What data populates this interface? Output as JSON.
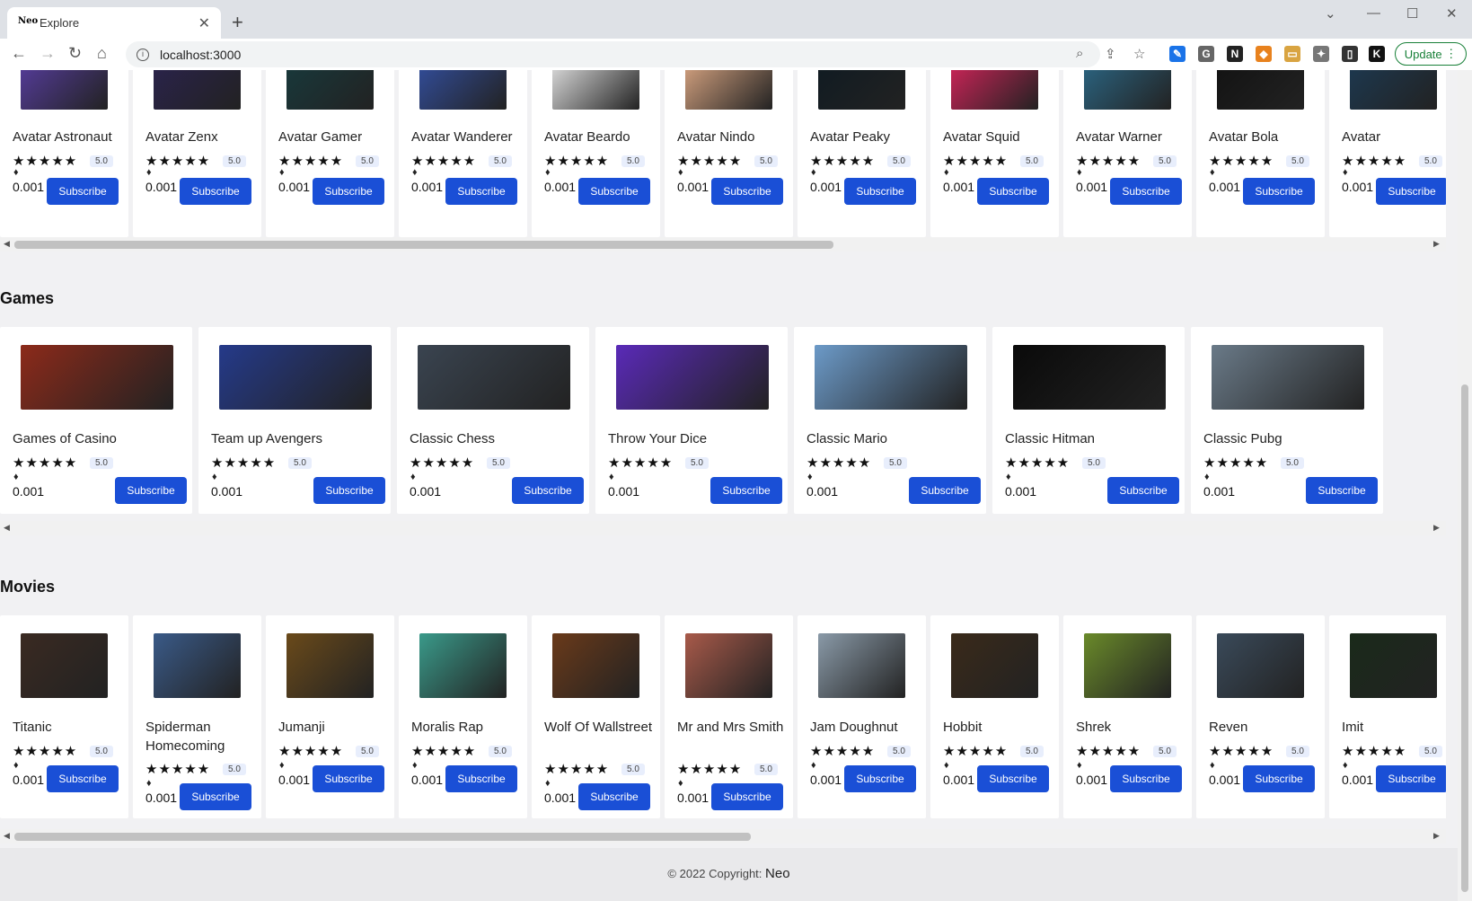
{
  "browser": {
    "tab_title": "Explore",
    "tab_favicon": "Neo",
    "url": "localhost:3000",
    "update_label": "Update"
  },
  "sections": [
    {
      "title": "",
      "items": [
        {
          "name": "Avatar Astronaut",
          "rating": "5.0",
          "price": "0.001",
          "button": "Subscribe",
          "color": "#5b3fa8"
        },
        {
          "name": "Avatar Zenx",
          "rating": "5.0",
          "price": "0.001",
          "button": "Subscribe",
          "color": "#2b2350"
        },
        {
          "name": "Avatar Gamer",
          "rating": "5.0",
          "price": "0.001",
          "button": "Subscribe",
          "color": "#173b3e"
        },
        {
          "name": "Avatar Wanderer",
          "rating": "5.0",
          "price": "0.001",
          "button": "Subscribe",
          "color": "#3452a8"
        },
        {
          "name": "Avatar Beardo",
          "rating": "5.0",
          "price": "0.001",
          "button": "Subscribe",
          "color": "#f2f2f2"
        },
        {
          "name": "Avatar Nindo",
          "rating": "5.0",
          "price": "0.001",
          "button": "Subscribe",
          "color": "#e8b08a"
        },
        {
          "name": "Avatar Peaky",
          "rating": "5.0",
          "price": "0.001",
          "button": "Subscribe",
          "color": "#0e1a22"
        },
        {
          "name": "Avatar Squid",
          "rating": "5.0",
          "price": "0.001",
          "button": "Subscribe",
          "color": "#e0245e"
        },
        {
          "name": "Avatar Warner",
          "rating": "5.0",
          "price": "0.001",
          "button": "Subscribe",
          "color": "#2c6c8c"
        },
        {
          "name": "Avatar Bola",
          "rating": "5.0",
          "price": "0.001",
          "button": "Subscribe",
          "color": "#111111"
        },
        {
          "name": "Avatar",
          "rating": "5.0",
          "price": "0.001",
          "button": "Subscribe",
          "color": "#1c3b55"
        }
      ]
    },
    {
      "title": "Games",
      "items": [
        {
          "name": "Games of Casino",
          "rating": "5.0",
          "price": "0.001",
          "button": "Subscribe",
          "color": "#8c2a1a"
        },
        {
          "name": "Team up Avengers",
          "rating": "5.0",
          "price": "0.001",
          "button": "Subscribe",
          "color": "#253a8a"
        },
        {
          "name": "Classic Chess",
          "rating": "5.0",
          "price": "0.001",
          "button": "Subscribe",
          "color": "#3a4450"
        },
        {
          "name": "Throw Your Dice",
          "rating": "5.0",
          "price": "0.001",
          "button": "Subscribe",
          "color": "#5a2ab8"
        },
        {
          "name": "Classic Mario",
          "rating": "5.0",
          "price": "0.001",
          "button": "Subscribe",
          "color": "#6c9ac8"
        },
        {
          "name": "Classic Hitman",
          "rating": "5.0",
          "price": "0.001",
          "button": "Subscribe",
          "color": "#0a0a0a"
        },
        {
          "name": "Classic Pubg",
          "rating": "5.0",
          "price": "0.001",
          "button": "Subscribe",
          "color": "#6a7a88"
        }
      ]
    },
    {
      "title": "Movies",
      "items": [
        {
          "name": "Titanic",
          "rating": "5.0",
          "price": "0.001",
          "button": "Subscribe",
          "color": "#3a2a22"
        },
        {
          "name": "Spiderman Homecoming",
          "rating": "5.0",
          "price": "0.001",
          "button": "Subscribe",
          "color": "#3a5a88"
        },
        {
          "name": "Jumanji",
          "rating": "5.0",
          "price": "0.001",
          "button": "Subscribe",
          "color": "#6a4a1a"
        },
        {
          "name": "Moralis Rap",
          "rating": "5.0",
          "price": "0.001",
          "button": "Subscribe",
          "color": "#3a9a8a"
        },
        {
          "name": "Wolf Of Wallstreet",
          "rating": "5.0",
          "price": "0.001",
          "button": "Subscribe",
          "color": "#6a3a1a"
        },
        {
          "name": "Mr and Mrs Smith",
          "rating": "5.0",
          "price": "0.001",
          "button": "Subscribe",
          "color": "#a85a4a"
        },
        {
          "name": "Jam Doughnut",
          "rating": "5.0",
          "price": "0.001",
          "button": "Subscribe",
          "color": "#8a9aa8"
        },
        {
          "name": "Hobbit",
          "rating": "5.0",
          "price": "0.001",
          "button": "Subscribe",
          "color": "#3a2a1a"
        },
        {
          "name": "Shrek",
          "rating": "5.0",
          "price": "0.001",
          "button": "Subscribe",
          "color": "#6a8a2a"
        },
        {
          "name": "Reven",
          "rating": "5.0",
          "price": "0.001",
          "button": "Subscribe",
          "color": "#3a4a5a"
        },
        {
          "name": "Imit",
          "rating": "5.0",
          "price": "0.001",
          "button": "Subscribe",
          "color": "#1a2a1a"
        }
      ]
    }
  ],
  "footer": {
    "text": "© 2022 Copyright:",
    "brand": "Neo"
  }
}
